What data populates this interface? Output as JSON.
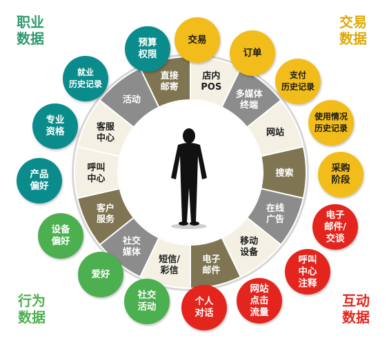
{
  "corners": {
    "top_left": "职业\n数据",
    "top_right": "交易\n数据",
    "bottom_left": "行为\n数据",
    "bottom_right": "互动\n数据"
  },
  "colors": {
    "teal": "#0b8c8c",
    "gold": "#f2bd1b",
    "red": "#e3251e",
    "green": "#4caf50",
    "ring_olive": "#7f7552",
    "ring_gray": "#8c8c8c",
    "ring_cream": "#f4f1e4"
  },
  "ring_segments": [
    {
      "label": "店内\nPOS",
      "style": "cream"
    },
    {
      "label": "多媒体\n终端",
      "style": "gray"
    },
    {
      "label": "网站",
      "style": "cream"
    },
    {
      "label": "搜索",
      "style": "olive"
    },
    {
      "label": "在线\n广告",
      "style": "gray"
    },
    {
      "label": "移动\n设备",
      "style": "cream"
    },
    {
      "label": "电子\n邮件",
      "style": "olive"
    },
    {
      "label": "短信/\n彩信",
      "style": "cream"
    },
    {
      "label": "社交\n媒体",
      "style": "gray"
    },
    {
      "label": "客户\n服务",
      "style": "olive"
    },
    {
      "label": "呼叫\n中心",
      "style": "cream"
    },
    {
      "label": "客服\n中心",
      "style": "cream"
    },
    {
      "label": "活动",
      "style": "gray"
    },
    {
      "label": "直接\n邮寄",
      "style": "olive"
    }
  ],
  "bubbles": [
    {
      "label": "预算\n权限",
      "color": "teal"
    },
    {
      "label": "交易",
      "color": "gold"
    },
    {
      "label": "订单",
      "color": "gold"
    },
    {
      "label": "支付\n历史记录",
      "color": "gold"
    },
    {
      "label": "使用情况\n历史记录",
      "color": "gold"
    },
    {
      "label": "采购\n阶段",
      "color": "gold"
    },
    {
      "label": "电子\n邮件/\n交谈",
      "color": "red"
    },
    {
      "label": "呼叫\n中心\n注释",
      "color": "red"
    },
    {
      "label": "网站\n点击\n流量",
      "color": "red"
    },
    {
      "label": "个人\n对话",
      "color": "red"
    },
    {
      "label": "社交\n活动",
      "color": "green"
    },
    {
      "label": "爱好",
      "color": "green"
    },
    {
      "label": "设备\n偏好",
      "color": "green"
    },
    {
      "label": "产品\n偏好",
      "color": "teal"
    },
    {
      "label": "专业\n资格",
      "color": "teal"
    },
    {
      "label": "就业\n历史记录",
      "color": "teal"
    }
  ]
}
